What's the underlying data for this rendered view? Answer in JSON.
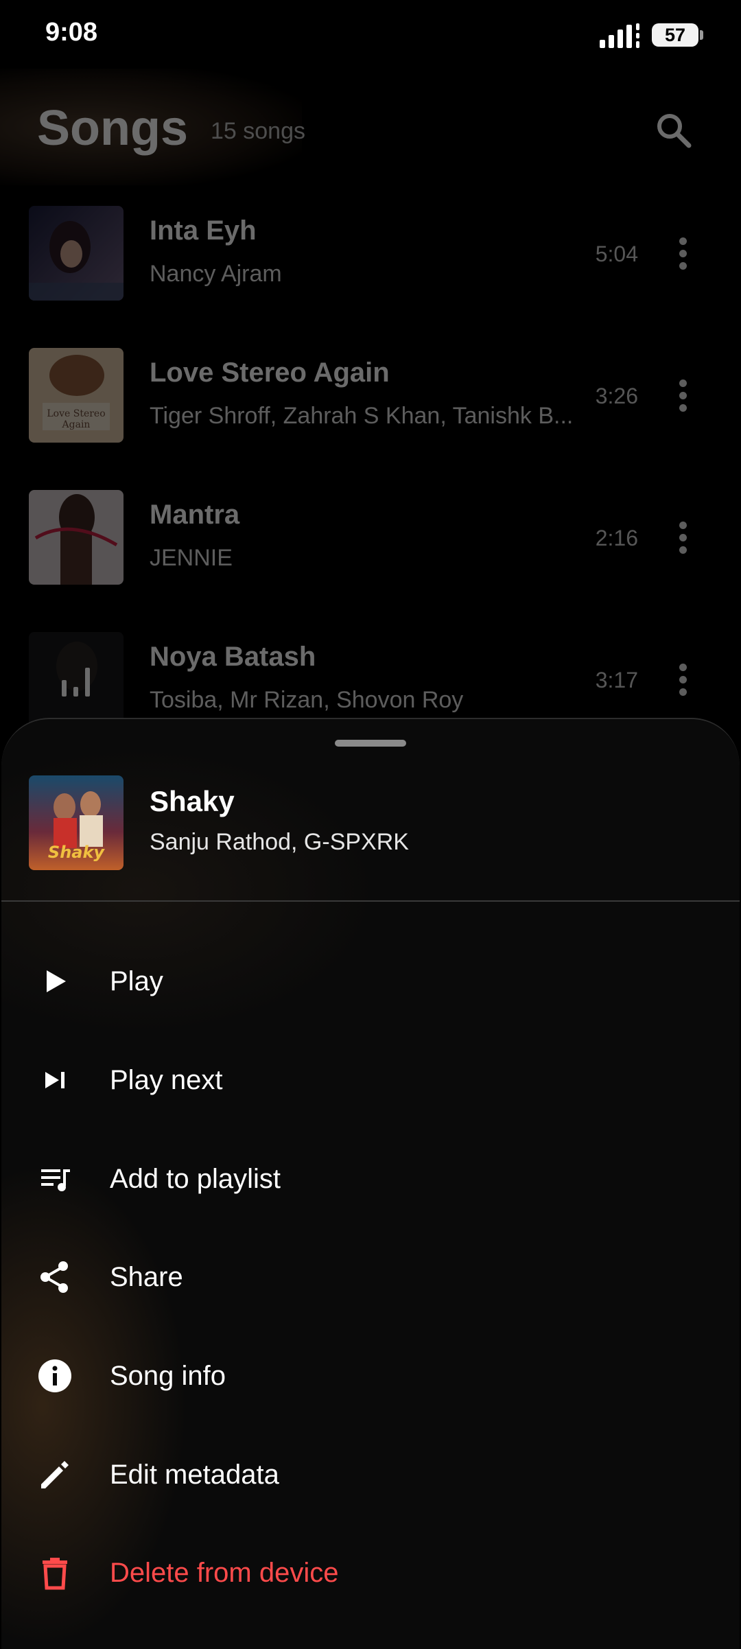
{
  "status_bar": {
    "time": "9:08",
    "battery": "57"
  },
  "header": {
    "title": "Songs",
    "count": "15 songs"
  },
  "songs": [
    {
      "title": "Inta Eyh",
      "artist": "Nancy Ajram",
      "duration": "5:04"
    },
    {
      "title": "Love Stereo Again",
      "artist": "Tiger Shroff, Zahrah S Khan, Tanishk B...",
      "duration": "3:26"
    },
    {
      "title": "Mantra",
      "artist": "JENNIE",
      "duration": "2:16"
    },
    {
      "title": "Noya Batash",
      "artist": "Tosiba, Mr Rizan, Shovon Roy",
      "duration": "3:17"
    }
  ],
  "sheet": {
    "title": "Shaky",
    "artist": "Sanju Rathod, G-SPXRK",
    "menu": [
      {
        "label": "Play",
        "icon": "play-icon"
      },
      {
        "label": "Play next",
        "icon": "skip-next-icon"
      },
      {
        "label": "Add to playlist",
        "icon": "playlist-add-icon"
      },
      {
        "label": "Share",
        "icon": "share-icon"
      },
      {
        "label": "Song info",
        "icon": "info-icon"
      },
      {
        "label": "Edit metadata",
        "icon": "edit-icon"
      },
      {
        "label": "Delete from device",
        "icon": "trash-icon"
      }
    ]
  },
  "colors": {
    "background": "#000000",
    "danger": "#ff4b4b",
    "sheet": "#0a0a0a"
  }
}
